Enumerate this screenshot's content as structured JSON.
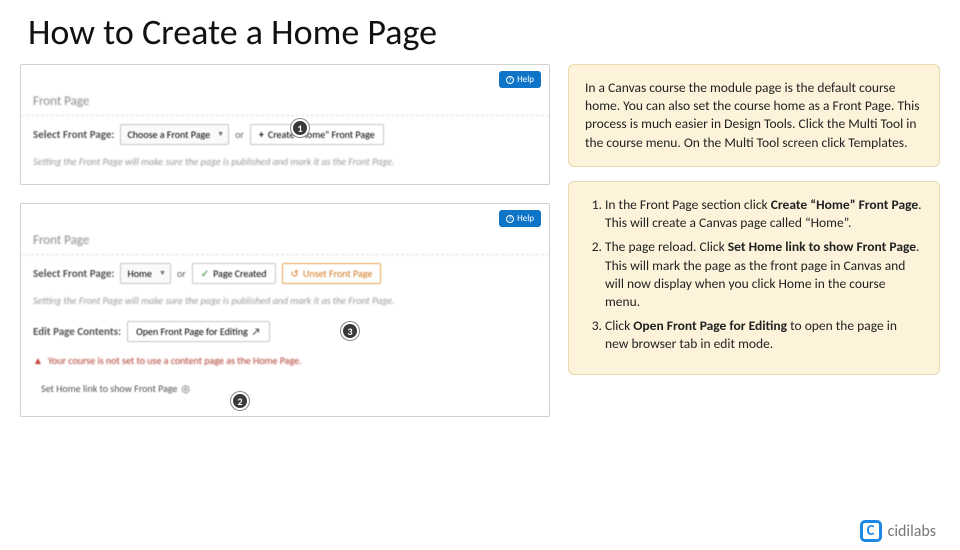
{
  "title": "How to Create a Home Page",
  "panel1": {
    "help": "Help",
    "header": "Front Page",
    "selectLabel": "Select Front Page:",
    "selectValue": "Choose a Front Page",
    "or": "or",
    "createBtn": "Create \"Home\" Front Page",
    "note": "Setting the Front Page will make sure the page is published and mark it as the Front Page.",
    "badge1": "1"
  },
  "panel2": {
    "help": "Help",
    "header": "Front Page",
    "selectLabel": "Select Front Page:",
    "selectValue": "Home",
    "or": "or",
    "createdBtn": "Page Created",
    "unsetBtn": "Unset Front Page",
    "note": "Setting the Front Page will make sure the page is published and mark it as the Front Page.",
    "editLabel": "Edit Page Contents:",
    "editBtn": "Open Front Page for Editing",
    "warn": "Your course is not set to use a content page as the Home Page.",
    "setBtn": "Set Home link to show Front Page",
    "badge2": "2",
    "badge3": "3"
  },
  "intro": "In a Canvas course the module page is the default course home. You can also set the course home as a Front Page. This process is much easier in Design Tools. Click the Multi Tool in the course menu. On the Multi Tool screen click Templates.",
  "steps": {
    "s1a": "In the Front Page section click ",
    "s1b": "Create “Home” Front Page",
    "s1c": ". This will create a Canvas page called “Home”.",
    "s2a": "The page reload. Click ",
    "s2b": "Set Home link to show Front Page",
    "s2c": ". This will mark the page as the front page in Canvas and will now display when you click Home in the course menu.",
    "s3a": "Click ",
    "s3b": "Open Front Page for Editing",
    "s3c": " to open the page in new browser tab in edit mode."
  },
  "logo": "cidilabs"
}
